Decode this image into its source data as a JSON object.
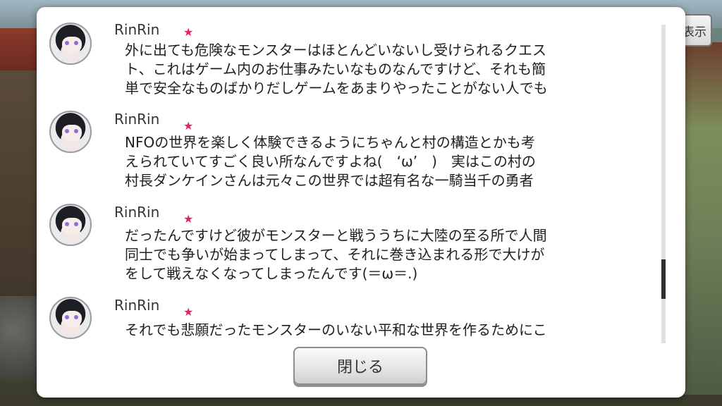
{
  "top_button_label": "表示",
  "entries": [
    {
      "name": "RinRin",
      "lines": [
        "外に出ても危険なモンスターはほとんどいないし受けられるクエス",
        "ト、これはゲーム内のお仕事みたいなものなんですけど、それも簡",
        "単で安全なものばかりだしゲームをあまりやったことがない人でも"
      ]
    },
    {
      "name": "RinRin",
      "lines": [
        "NFOの世界を楽しく体験できるようにちゃんと村の構造とかも考",
        "えられていてすごく良い所なんですよね(　‘ω’　)　実はこの村の",
        "村長ダンケインさんは元々この世界では超有名な一騎当千の勇者"
      ]
    },
    {
      "name": "RinRin",
      "lines": [
        "だったんですけど彼がモンスターと戦ううちに大陸の至る所で人間",
        "同士でも争いが始まってしまって、それに巻き込まれる形で大けが",
        "をして戦えなくなってしまったんです(＝ω＝.)"
      ]
    },
    {
      "name": "RinRin",
      "lines": [
        "それでも悲願だったモンスターのいない平和な世界を作るためにこ"
      ]
    }
  ],
  "close_label": "閉じる",
  "icons": {
    "star": "star-icon",
    "avatar": "avatar-icon"
  },
  "colors": {
    "star": "#e5245a",
    "dialog_bg": "#ffffff"
  }
}
